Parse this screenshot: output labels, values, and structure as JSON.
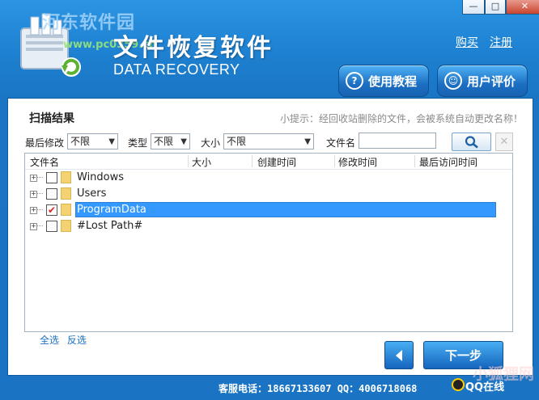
{
  "header": {
    "title": "文件恢复软件",
    "subtitle": "DATA RECOVERY",
    "watermark": "河东软件园",
    "watermark_url": "www.pc0359.cn",
    "buy_link": "购买",
    "register_link": "注册",
    "tutorial_button": "使用教程",
    "feedback_button": "用户评价"
  },
  "window_controls": {
    "minimize": "—",
    "maximize": "□",
    "close": "✕"
  },
  "panel": {
    "title": "扫描结果",
    "hint": "小提示：经回收站删除的文件，会被系统自动更改名称！"
  },
  "filters": {
    "last_modified_label": "最后修改",
    "last_modified_value": "不限",
    "type_label": "类型",
    "type_value": "不限",
    "size_label": "大小",
    "size_value": "不限",
    "filename_label": "文件名",
    "filename_value": ""
  },
  "table": {
    "columns": [
      "文件名",
      "大小",
      "创建时间",
      "修改时间",
      "最后访问时间"
    ],
    "rows": [
      {
        "name": "Windows",
        "checked": false,
        "selected": false
      },
      {
        "name": "Users",
        "checked": false,
        "selected": false
      },
      {
        "name": "ProgramData",
        "checked": true,
        "selected": true
      },
      {
        "name": "#Lost Path#",
        "checked": false,
        "selected": false
      }
    ]
  },
  "selection": {
    "select_all": "全选",
    "invert": "反选"
  },
  "nav": {
    "back_icon": "triangle-left",
    "next_label": "下一步"
  },
  "footer": {
    "service": "客服电话：18667133607 QQ：4006718068",
    "qq_online": "QQ在线",
    "watermark2": "小狐狸网"
  },
  "colors": {
    "accent": "#1f82d2",
    "selection": "#3399ff",
    "check": "#dd2222"
  }
}
